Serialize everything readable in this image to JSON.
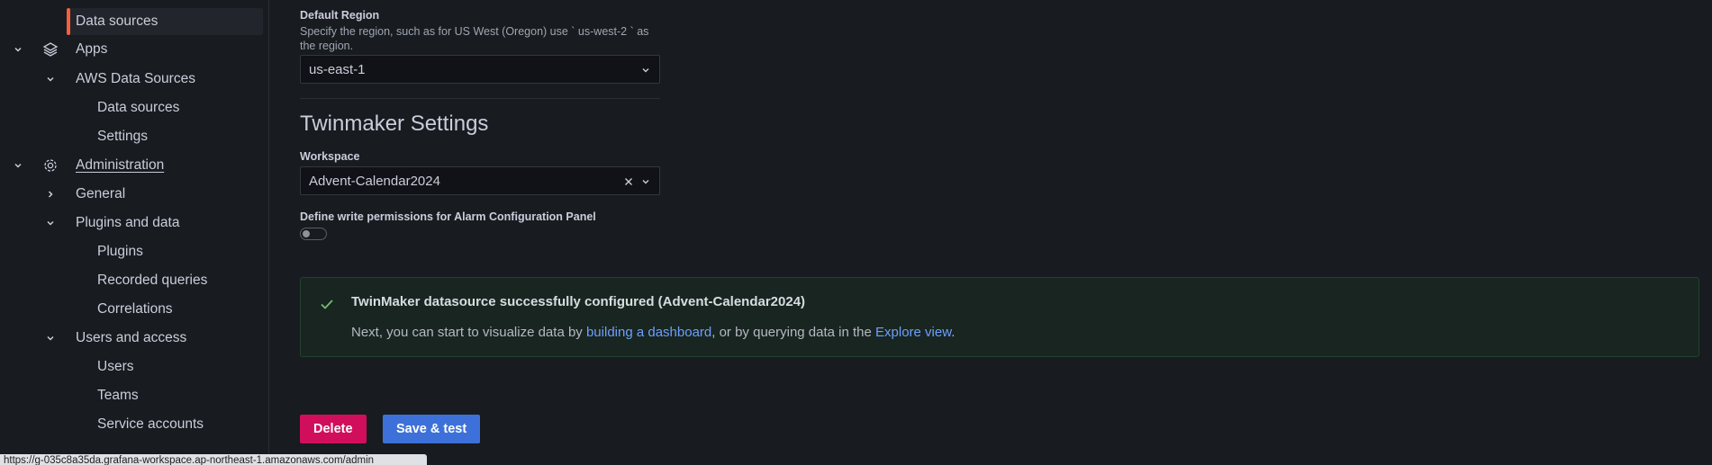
{
  "sidebar": {
    "items": [
      {
        "label": "Data sources",
        "active": true
      },
      {
        "label": "Apps"
      },
      {
        "label": "AWS Data Sources"
      },
      {
        "label": "Data sources"
      },
      {
        "label": "Settings"
      },
      {
        "label": "Administration"
      },
      {
        "label": "General"
      },
      {
        "label": "Plugins and data"
      },
      {
        "label": "Plugins"
      },
      {
        "label": "Recorded queries"
      },
      {
        "label": "Correlations"
      },
      {
        "label": "Users and access"
      },
      {
        "label": "Users"
      },
      {
        "label": "Teams"
      },
      {
        "label": "Service accounts"
      }
    ]
  },
  "region": {
    "label": "Default Region",
    "description": "Specify the region, such as for US West (Oregon) use ` us-west-2 ` as the region.",
    "value": "us-east-1"
  },
  "twinmaker": {
    "section_title": "Twinmaker Settings",
    "workspace_label": "Workspace",
    "workspace_value": "Advent-Calendar2024",
    "alarm_label": "Define write permissions for Alarm Configuration Panel",
    "alarm_enabled": false
  },
  "alert": {
    "title": "TwinMaker datasource successfully configured (Advent-Calendar2024)",
    "body_prefix": "Next, you can start to visualize data by ",
    "link1": "building a dashboard",
    "body_middle": ", or by querying data in the ",
    "link2": "Explore view",
    "body_suffix": "."
  },
  "actions": {
    "delete_label": "Delete",
    "save_label": "Save & test"
  },
  "statusbar": {
    "url": "https://g-035c8a35da.grafana-workspace.ap-northeast-1.amazonaws.com/admin"
  },
  "colors": {
    "accent": "#f55f3e",
    "danger": "#d10e5c",
    "primary": "#3d71d9",
    "success": "#73bf69",
    "link": "#6e9fff"
  }
}
